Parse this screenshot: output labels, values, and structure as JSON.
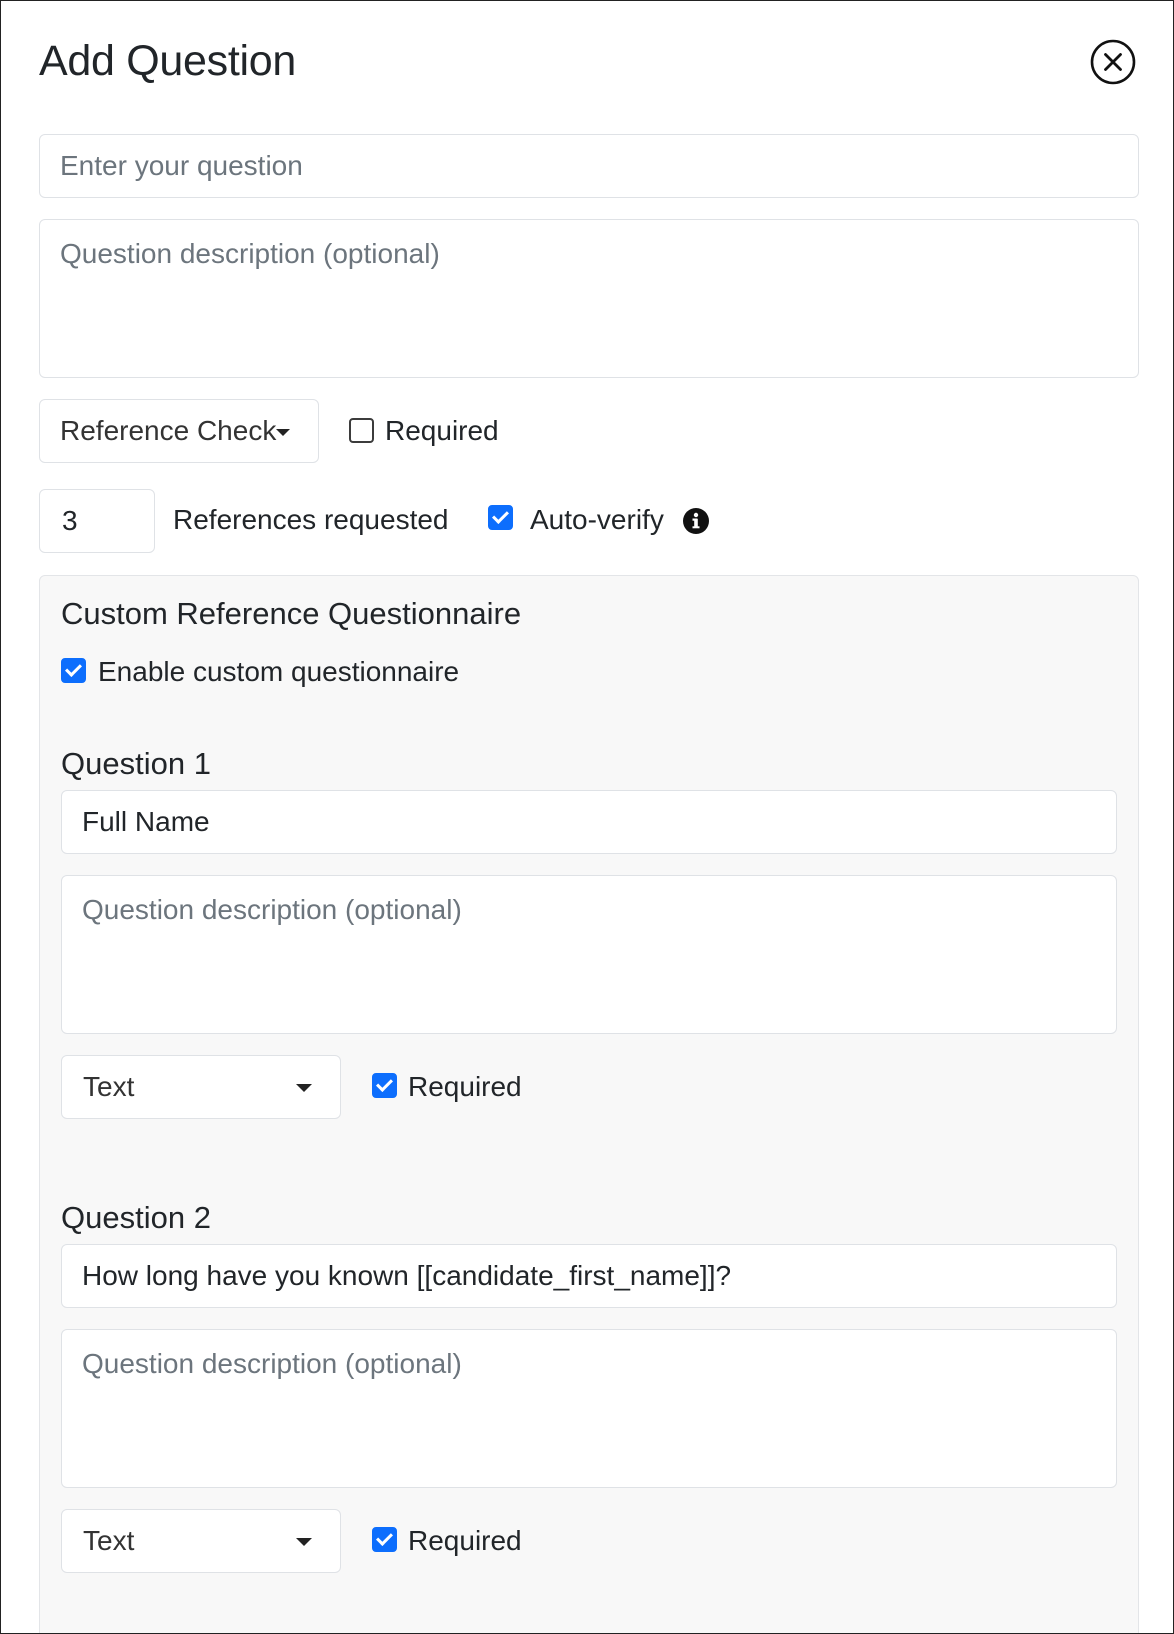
{
  "modal": {
    "title": "Add Question",
    "close_icon": "close-circle-icon"
  },
  "question": {
    "placeholder": "Enter your question",
    "description_placeholder": "Question description (optional)",
    "type": "Reference Check",
    "required_label": "Required",
    "required_checked": false
  },
  "references": {
    "count": "3",
    "label": "References requested",
    "auto_verify_label": "Auto-verify",
    "auto_verify_checked": true,
    "info_icon": "info-circle-icon"
  },
  "questionnaire": {
    "heading": "Custom Reference Questionnaire",
    "enable_label": "Enable custom questionnaire",
    "enable_checked": true,
    "items": [
      {
        "heading": "Question 1",
        "value": "Full Name",
        "description_placeholder": "Question description (optional)",
        "type": "Text",
        "required_label": "Required",
        "required_checked": true
      },
      {
        "heading": "Question 2",
        "value": "How long have you known [[candidate_first_name]]?",
        "description_placeholder": "Question description (optional)",
        "type": "Text",
        "required_label": "Required",
        "required_checked": true
      }
    ]
  },
  "colors": {
    "accent": "#0d6efd",
    "panel_background": "#f8f8f8",
    "border": "#dfe2e6"
  }
}
